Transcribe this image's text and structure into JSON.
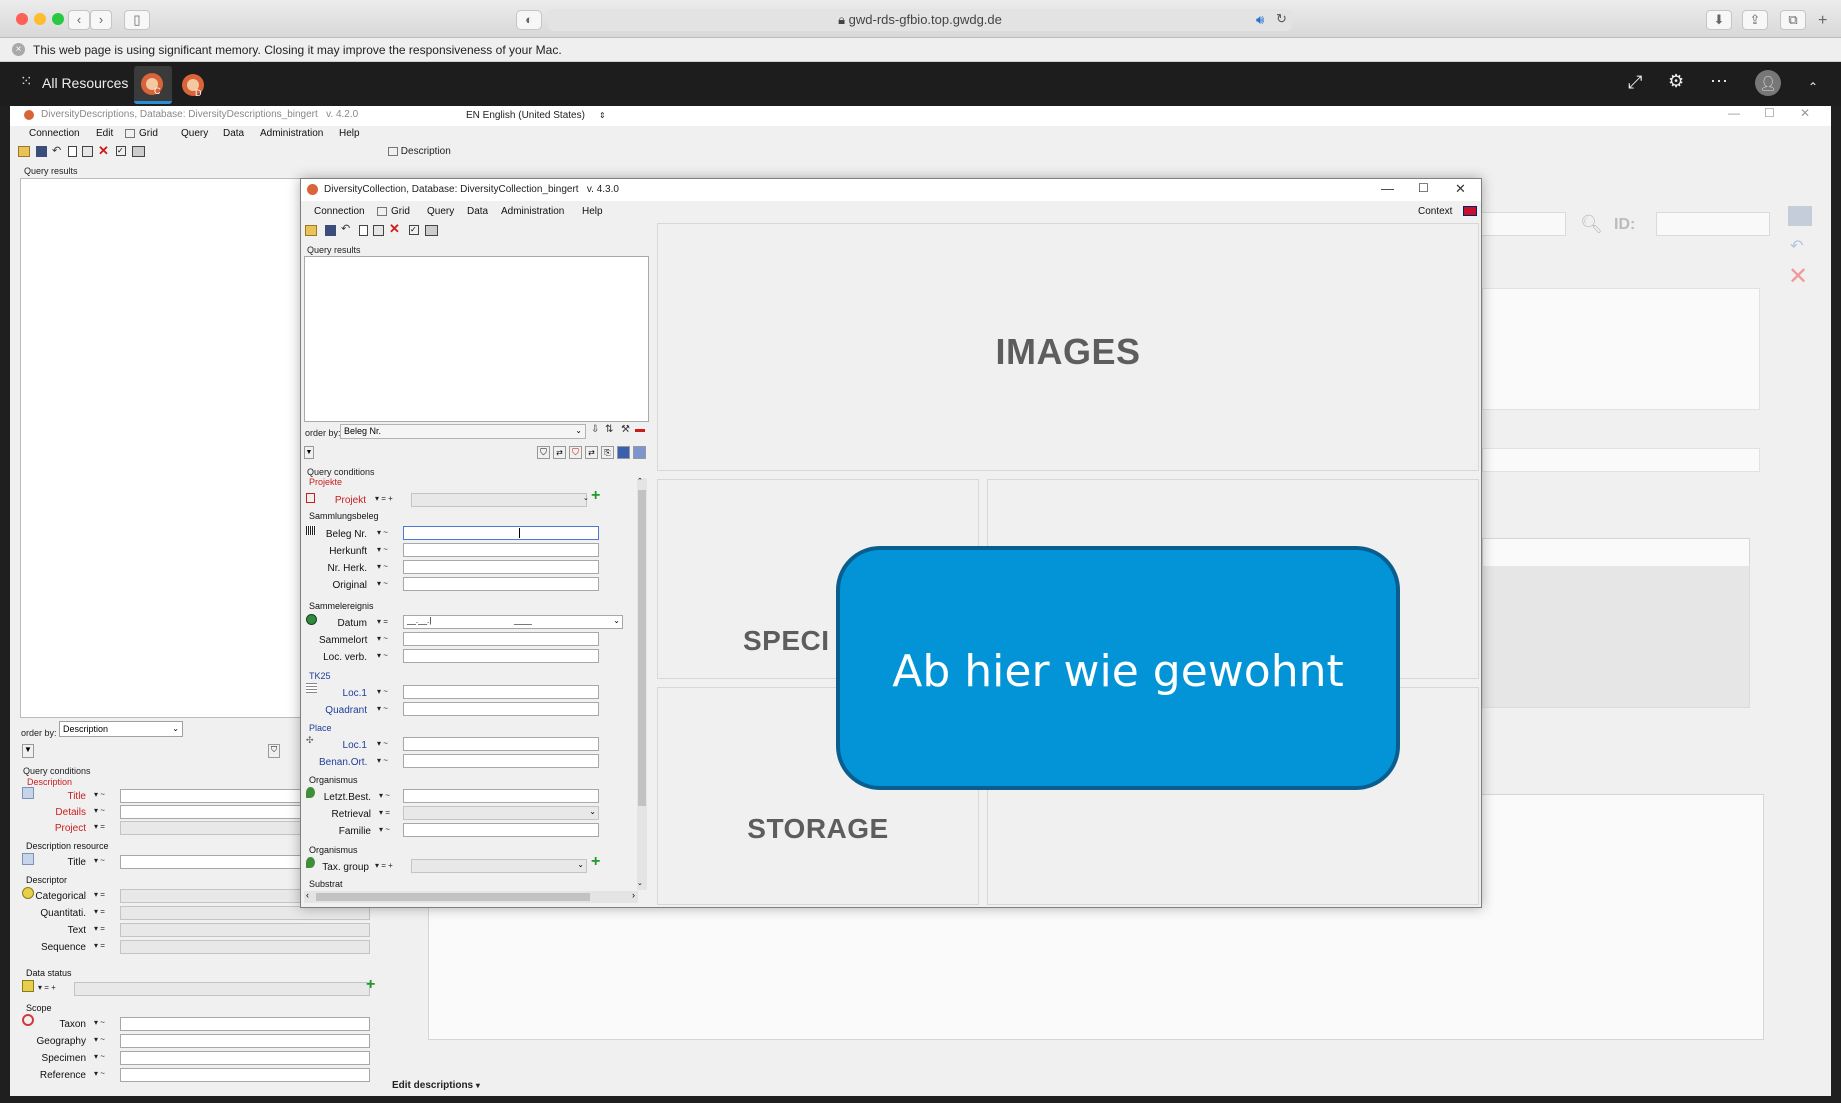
{
  "browser": {
    "url": "gwd-rds-gfbio.top.gwdg.de",
    "memory_warning": "This web page is using significant memory. Closing it may improve the responsiveness of your Mac.",
    "resources_label": "All Resources"
  },
  "dd_window": {
    "title": "DiversityDescriptions,  Database: DiversityDescriptions_bingert",
    "version": "v. 4.2.0",
    "language": "EN English (United States)",
    "menu": [
      "Connection",
      "Edit",
      "Grid",
      "Query",
      "Data",
      "Administration",
      "Help"
    ],
    "tab_description": "Description",
    "query_results": "Query results",
    "order_by_label": "order by:",
    "order_by_value": "Description",
    "query_conditions": "Query conditions",
    "sections": {
      "description": "Description",
      "description_resource": "Description resource",
      "descriptor": "Descriptor",
      "data_status": "Data status",
      "scope": "Scope"
    },
    "fields": {
      "title": "Title",
      "details": "Details",
      "project": "Project",
      "res_title": "Title",
      "categorical": "Categorical",
      "quantitative": "Quantitati.",
      "text": "Text",
      "sequence": "Sequence",
      "taxon": "Taxon",
      "geography": "Geography",
      "specimen": "Specimen",
      "reference": "Reference"
    },
    "id_label": "ID:",
    "edit_descriptions": "Edit descriptions"
  },
  "dc_window": {
    "title": "DiversityCollection,  Database: DiversityCollection_bingert",
    "version": "v. 4.3.0",
    "menu": [
      "Connection",
      "Grid",
      "Query",
      "Data",
      "Administration",
      "Help"
    ],
    "context": "Context",
    "query_results": "Query results",
    "order_by_label": "order by:",
    "order_by_value": "Beleg Nr.",
    "query_conditions": "Query conditions",
    "sections": {
      "projekte": "Projekte",
      "sammlungsbeleg": "Sammlungsbeleg",
      "sammelereignis": "Sammelereignis",
      "tk25": "TK25",
      "place": "Place",
      "organismus1": "Organismus",
      "organismus2": "Organismus",
      "substrat": "Substrat"
    },
    "fields": {
      "projekt": "Projekt",
      "beleg_nr": "Beleg Nr.",
      "herkunft": "Herkunft",
      "nr_herk": "Nr. Herk.",
      "original": "Original",
      "datum": "Datum",
      "sammelort": "Sammelort",
      "loc_verb": "Loc. verb.",
      "loc1_tk": "Loc.1",
      "quadrant": "Quadrant",
      "loc1_place": "Loc.1",
      "benan_ort": "Benan.Ort.",
      "letzt_best": "Letzt.Best.",
      "retrieval": "Retrieval",
      "familie": "Familie",
      "tax_group": "Tax. group"
    },
    "panels": {
      "images": "IMAGES",
      "specimen": "SPECI",
      "storage": "STORAGE"
    }
  },
  "callout": {
    "text": "Ab hier wie gewohnt"
  },
  "colors": {
    "callout_fill": "#0294d6",
    "callout_border": "#0a5d8f",
    "required_label": "#c81e1e"
  }
}
